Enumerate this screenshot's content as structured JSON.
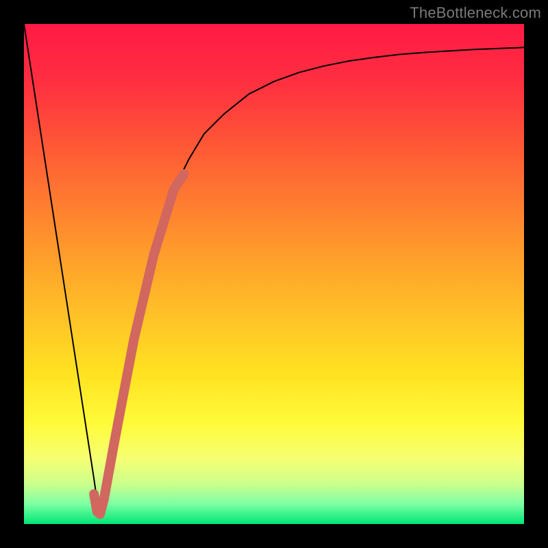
{
  "watermark": "TheBottleneck.com",
  "chart_data": {
    "type": "line",
    "title": "",
    "xlabel": "",
    "ylabel": "",
    "xlim": [
      0,
      100
    ],
    "ylim": [
      0,
      100
    ],
    "grid": false,
    "legend": false,
    "background_gradient_stops": [
      {
        "offset": 0.0,
        "color": "#ff1a45"
      },
      {
        "offset": 0.12,
        "color": "#ff3040"
      },
      {
        "offset": 0.25,
        "color": "#ff5a35"
      },
      {
        "offset": 0.4,
        "color": "#ff8a2e"
      },
      {
        "offset": 0.55,
        "color": "#ffb828"
      },
      {
        "offset": 0.7,
        "color": "#ffe222"
      },
      {
        "offset": 0.8,
        "color": "#fffb3a"
      },
      {
        "offset": 0.87,
        "color": "#f6ff73"
      },
      {
        "offset": 0.92,
        "color": "#ccff8c"
      },
      {
        "offset": 0.96,
        "color": "#7dffa3"
      },
      {
        "offset": 1.0,
        "color": "#00e676"
      }
    ],
    "series": [
      {
        "name": "bottleneck-curve",
        "color": "#000000",
        "stroke_width": 2,
        "x": [
          0,
          2,
          4,
          6,
          8,
          10,
          12,
          14,
          15,
          16,
          18,
          20,
          22,
          24,
          26,
          28,
          30,
          33,
          36,
          40,
          45,
          50,
          55,
          60,
          65,
          70,
          75,
          80,
          85,
          90,
          95,
          100
        ],
        "y": [
          100,
          87,
          74,
          61,
          48,
          35,
          22,
          9,
          2,
          5,
          16,
          27,
          37,
          46,
          54,
          61,
          67,
          73,
          78,
          82,
          86,
          88.5,
          90.3,
          91.6,
          92.6,
          93.3,
          93.9,
          94.3,
          94.6,
          94.9,
          95.1,
          95.3
        ]
      },
      {
        "name": "highlight-segment",
        "color": "#d1675f",
        "stroke_width": 14,
        "linecap": "round",
        "x": [
          15.2,
          16.0,
          18.0,
          22.0,
          26.0,
          30.0,
          32.0
        ],
        "y": [
          2.0,
          5.0,
          16.0,
          37.0,
          54.0,
          67.0,
          70.0
        ]
      },
      {
        "name": "highlight-hook",
        "color": "#d1675f",
        "stroke_width": 14,
        "linecap": "round",
        "x": [
          14.0,
          14.6,
          15.2,
          16.0
        ],
        "y": [
          6.0,
          2.5,
          2.0,
          5.0
        ]
      }
    ]
  }
}
